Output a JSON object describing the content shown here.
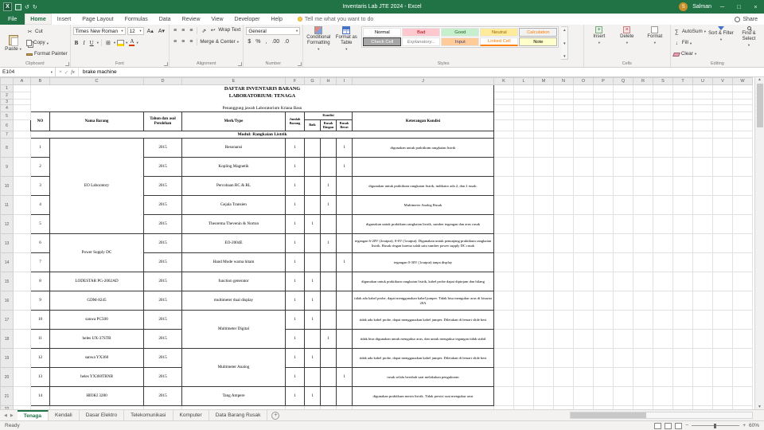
{
  "titlebar": {
    "title": "Inventaris Lab JTE 2024 - Excel",
    "user_name": "Salman",
    "user_initial": "S"
  },
  "ribbon_tabs": {
    "file": "File",
    "tabs": [
      "Home",
      "Insert",
      "Page Layout",
      "Formulas",
      "Data",
      "Review",
      "View",
      "Developer",
      "Help"
    ],
    "active": "Home",
    "tell_me": "Tell me what you want to do",
    "share": "Share"
  },
  "ribbon": {
    "clipboard": {
      "label": "Clipboard",
      "paste": "Paste",
      "cut": "Cut",
      "copy": "Copy",
      "format_painter": "Format Painter"
    },
    "font": {
      "label": "Font",
      "name": "Times New Roman",
      "size": "12",
      "bold": "B",
      "italic": "I",
      "underline": "U"
    },
    "alignment": {
      "label": "Alignment",
      "wrap_text": "Wrap Text",
      "merge_center": "Merge & Center"
    },
    "number": {
      "label": "Number",
      "format": "General",
      "currency": "$",
      "percent": "%",
      "comma": ",",
      "inc_decimal": ".00",
      "dec_decimal": ".0"
    },
    "styles": {
      "label": "Styles",
      "conditional_formatting": "Conditional Formatting",
      "format_as_table": "Format as Table",
      "gallery": [
        {
          "name": "Normal"
        },
        {
          "name": "Bad"
        },
        {
          "name": "Good"
        },
        {
          "name": "Neutral"
        },
        {
          "name": "Calculation"
        },
        {
          "name": "Check Cell"
        },
        {
          "name": "Explanatory..."
        },
        {
          "name": "Input"
        },
        {
          "name": "Linked Cell"
        },
        {
          "name": "Note"
        }
      ]
    },
    "cells": {
      "label": "Cells",
      "insert": "Insert",
      "delete": "Delete",
      "format": "Format"
    },
    "editing": {
      "label": "Editing",
      "autosum": "AutoSum",
      "fill": "Fill",
      "clear": "Clear",
      "sort_filter": "Sort & Filter",
      "find_select": "Find & Select"
    }
  },
  "formula_bar": {
    "name_box": "E104",
    "value": "brake machine"
  },
  "sheet": {
    "columns": [
      "A",
      "B",
      "C",
      "D",
      "E",
      "F",
      "G",
      "H",
      "I",
      "J",
      "K",
      "L",
      "M",
      "N",
      "O",
      "P",
      "Q",
      "R",
      "S",
      "T",
      "U",
      "V",
      "W"
    ],
    "visible_rows": 22
  },
  "table": {
    "title_line1": "DAFTAR INVENTARIS BARANG",
    "title_line2": "LABORATORIUM: TENAGA",
    "subtitle": "Penanggung jawab Laboratorium Kriana Basu",
    "headers": {
      "no": "NO",
      "nama": "Nama Barang",
      "tahun": "Tahun dan asal Perolehan",
      "merk": "Merk/Type",
      "jumlah": "Jumlah Barang",
      "kondisi": "Kondisi",
      "baik": "Baik",
      "rusak_ringan": "Rusak Ringan",
      "rusak_berat": "Rusak Berat",
      "keterangan": "Keterangan Kondisi"
    },
    "section": "Modul: Rangkaian Listrik",
    "rows": [
      {
        "no": "1",
        "nama": "EO Laboratory",
        "nama_span": 5,
        "tahun": "2015",
        "merk": "Resonansi",
        "jumlah": "1",
        "baik": "",
        "ringan": "",
        "berat": "1",
        "ket": "digunakan untuk praktikum rangkaian listrik"
      },
      {
        "no": "2",
        "nama": null,
        "tahun": "2015",
        "merk": "Kopling Magnetik",
        "jumlah": "1",
        "baik": "",
        "ringan": "",
        "berat": "1",
        "ket": ""
      },
      {
        "no": "3",
        "nama": null,
        "tahun": "2015",
        "merk": "Percobaan RC & RL",
        "jumlah": "1",
        "baik": "",
        "ringan": "1",
        "berat": "",
        "ket": "digunakan untuk praktikum rangkaian listrik, indikator ada 2, dan 2 rusak."
      },
      {
        "no": "4",
        "nama": null,
        "tahun": "2015",
        "merk": "Gejala Transien",
        "jumlah": "1",
        "baik": "",
        "ringan": "1",
        "berat": "",
        "ket": "Multimeter Analog Rusak"
      },
      {
        "no": "5",
        "nama": null,
        "tahun": "2015",
        "merk": "Theorema Thevenin & Norton",
        "jumlah": "1",
        "baik": "1",
        "ringan": "",
        "berat": "",
        "ket": "digunakan untuk praktikum rangkaian listrik, sumber tegangan dan arus rusak"
      },
      {
        "no": "6",
        "nama": "Power Supply DC",
        "nama_span": 2,
        "tahun": "2015",
        "merk": "EO-2004E",
        "jumlah": "1",
        "baik": "",
        "ringan": "1",
        "berat": "",
        "ket": "tegangan 6-20V (2output), 0-6V (1output). Digunakan untuk penunjang praktikum rangkaian listrik. Rusak ringan karena salah satu sumber power supply DC rusak"
      },
      {
        "no": "7",
        "nama": null,
        "tahun": "2015",
        "merk": "Hand Mode warna hitam",
        "jumlah": "1",
        "baik": "",
        "ringan": "",
        "berat": "1",
        "ket": "tegangan 0-30V (1output) tanpa display"
      },
      {
        "no": "8",
        "nama": "LODESTAR PG-2002AD",
        "tahun": "2015",
        "merk": "function generator",
        "jumlah": "1",
        "baik": "1",
        "ringan": "",
        "berat": "",
        "ket": "digunakan untuk praktikum rangkaian listrik, kabel probe dapat dipinjam dan hilang"
      },
      {
        "no": "9",
        "nama": "GDM-8245",
        "tahun": "2015",
        "merk": "multimeter dual display",
        "jumlah": "1",
        "baik": "1",
        "ringan": "",
        "berat": "",
        "ket": "tidak ada kabel probe, dapat menggunakan kabel jumper. Tidak bisa mengukur arus di kisaran 20A"
      },
      {
        "no": "10",
        "nama": "sanwa PC500",
        "tahun": "2015",
        "merk": "Multimeter Digital",
        "merk_span": 2,
        "jumlah": "1",
        "baik": "1",
        "ringan": "",
        "berat": "",
        "ket": "tidak ada kabel probe, dapat menggunakan kabel jumper. Diletakan di lemari slide besi"
      },
      {
        "no": "11",
        "nama": "heles UX-37STR",
        "tahun": "2015",
        "merk": null,
        "jumlah": "1",
        "baik": "",
        "ringan": "1",
        "berat": "",
        "ket": "tidak bisa digunakan untuk mengukur arus, dan untuk mengukur tegangan tidak stabil"
      },
      {
        "no": "12",
        "nama": "sanwa YX360",
        "tahun": "2015",
        "merk": "Multimeter Analog",
        "merk_span": 2,
        "jumlah": "1",
        "baik": "1",
        "ringan": "",
        "berat": "",
        "ket": "tidak ada kabel probe, dapat menggunakan kabel jumper. Diletakan di lemari slide besi"
      },
      {
        "no": "13",
        "nama": "heles YX360TRNB",
        "tahun": "2015",
        "merk": null,
        "jumlah": "1",
        "baik": "",
        "ringan": "",
        "berat": "1",
        "ket": "rusak selalu berubah saat melakukan pengukuran"
      },
      {
        "no": "14",
        "nama": "HIOKI 3280",
        "tahun": "2015",
        "merk": "Tang Ampere",
        "jumlah": "1",
        "baik": "1",
        "ringan": "",
        "berat": "",
        "ket": "digunakan praktikum mesin listrik. Tidak presisi saat mengukur arus"
      }
    ]
  },
  "sheet_tabs": {
    "tabs": [
      "Tenaga",
      "Kendali",
      "Dasar Elektro",
      "Telekomunikasi",
      "Komputer",
      "Data Barang Rusak"
    ],
    "active": "Tenaga"
  },
  "status_bar": {
    "mode": "Ready",
    "zoom": "60%"
  }
}
